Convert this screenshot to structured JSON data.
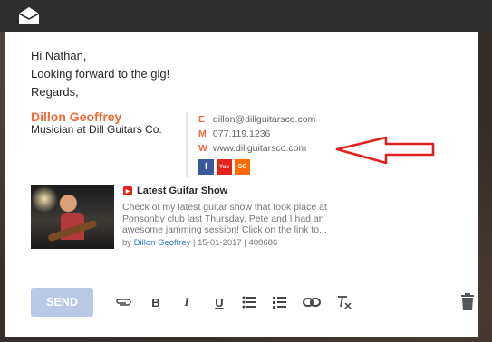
{
  "icons": {
    "mail": "envelope-open-icon",
    "attach": "paperclip-icon",
    "bold": "bold-icon",
    "italic": "italic-icon",
    "underline": "underline-icon",
    "bullets": "bulleted-list-icon",
    "numbers": "numbered-list-icon",
    "link": "link-icon",
    "clear": "clear-format-icon",
    "delete": "trash-icon"
  },
  "message": {
    "greeting": "Hi Nathan,",
    "line1": "Looking forward to the gig!",
    "closing": "Regards,"
  },
  "signature": {
    "name": "Dillon Geoffrey",
    "title": "Musician at Dill Guitars Co.",
    "email_label": "E",
    "email": "dillon@dillguitarsco.com",
    "mobile_label": "M",
    "mobile": "077.119.1236",
    "web_label": "W",
    "web": "www.dillguitarsco.com",
    "social": [
      "f",
      "You",
      "SC"
    ]
  },
  "video": {
    "title": "Latest Guitar Show",
    "description": "Check ot my latest guitar show that took place at Ponsonby club last Thursday. Pete and I had an awesome jamming session! Click on the link to...",
    "by_label": "by",
    "author": "Dillon Geoffrey",
    "date": "15-01-2017",
    "views": "408686"
  },
  "toolbar": {
    "send_label": "SEND",
    "bold": "B",
    "italic": "I",
    "underline": "U"
  },
  "colors": {
    "accent": "#f0693a",
    "send": "#b9c9e7",
    "facebook": "#3b5998",
    "youtube": "#e62117",
    "soundcloud": "#ff6a00",
    "annotation_arrow": "#e02020"
  }
}
